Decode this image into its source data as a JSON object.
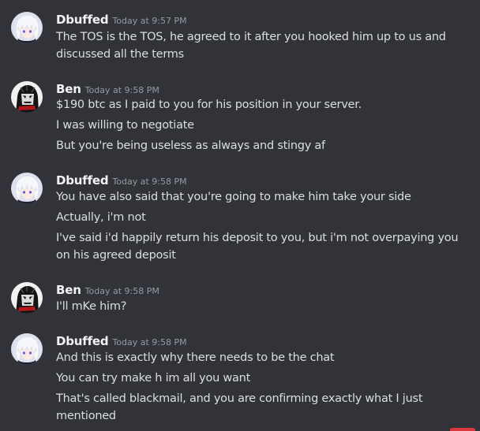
{
  "messages": [
    {
      "username": "Dbuffed",
      "timestamp": "Today at 9:57 PM",
      "avatar": "anime-white-hair-avatar-icon",
      "lines": [
        "The TOS is the TOS, he agreed to it after you hooked him up to us and",
        "discussed all the terms"
      ]
    },
    {
      "username": "Ben",
      "timestamp": "Today at 9:58 PM",
      "avatar": "dark-character-avatar-icon",
      "lines": [
        "$190 btc as I paid to you for his position in your server.",
        "I was willing to negotiate",
        "But you're being useless as always and stingy af"
      ]
    },
    {
      "username": "Dbuffed",
      "timestamp": "Today at 9:58 PM",
      "avatar": "anime-white-hair-avatar-icon",
      "lines": [
        "You have also said that you're going to make him take your side",
        "Actually, i'm not",
        "I've said i'd happily return his deposit to you, but i'm not overpaying you",
        "on his agreed deposit"
      ]
    },
    {
      "username": "Ben",
      "timestamp": "Today at 9:58 PM",
      "avatar": "dark-character-avatar-icon",
      "lines": [
        "I'll mKe him?"
      ]
    },
    {
      "username": "Dbuffed",
      "timestamp": "Today at 9:58 PM",
      "avatar": "anime-white-hair-avatar-icon",
      "lines": [
        "And this is exactly why there needs to be the chat",
        "You can try make h im all you want",
        "That's called blackmail, and you are confirming exactly what I just",
        "mentioned"
      ]
    }
  ],
  "colors": {
    "background": "#313338",
    "username": "#f2f3f5",
    "timestamp": "#949ba4",
    "text": "#dbdee1",
    "badge": "#da373c"
  }
}
